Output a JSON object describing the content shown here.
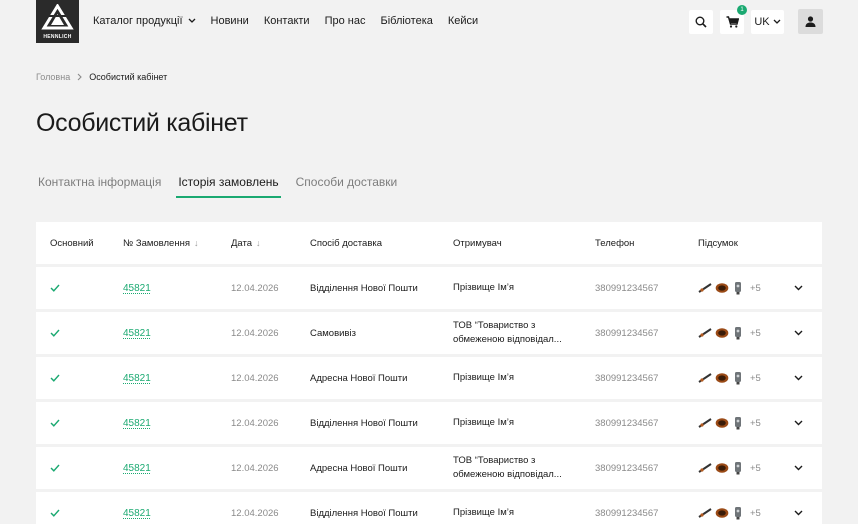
{
  "brand": {
    "logo_text": "HENNLICH"
  },
  "nav": [
    {
      "label": "Каталог продукції",
      "dropdown": true
    },
    {
      "label": "Новини"
    },
    {
      "label": "Контакти"
    },
    {
      "label": "Про нас"
    },
    {
      "label": "Бібліотека"
    },
    {
      "label": "Кейси"
    }
  ],
  "header_actions": {
    "cart_count": "1",
    "language": "UK"
  },
  "breadcrumb": {
    "home": "Головна",
    "current": "Особистий кабінет"
  },
  "page_title": "Особистий кабінет",
  "tabs": [
    {
      "label": "Контактна інформація",
      "active": false
    },
    {
      "label": "Історія замовлень",
      "active": true
    },
    {
      "label": "Способи доставки",
      "active": false
    }
  ],
  "table": {
    "headers": {
      "main": "Основний",
      "order_no": "№ Замовлення",
      "date": "Дата",
      "delivery": "Спосіб доставка",
      "recipient": "Отримувач",
      "phone": "Телефон",
      "summary": "Підсумок"
    },
    "rows": [
      {
        "order": "45821",
        "date": "12.04.2026",
        "delivery": "Відділення Нової Пошти",
        "recipient": "Прізвище Ім’я",
        "phone": "380991234567",
        "more": "+5"
      },
      {
        "order": "45821",
        "date": "12.04.2026",
        "delivery": "Самовивіз",
        "recipient": "ТОВ “Товариство з обмеженою відповідал...",
        "phone": "380991234567",
        "more": "+5"
      },
      {
        "order": "45821",
        "date": "12.04.2026",
        "delivery": "Адресна Нової Пошти",
        "recipient": "Прізвище Ім’я",
        "phone": "380991234567",
        "more": "+5"
      },
      {
        "order": "45821",
        "date": "12.04.2026",
        "delivery": "Відділення Нової Пошти",
        "recipient": "Прізвище Ім’я",
        "phone": "380991234567",
        "more": "+5"
      },
      {
        "order": "45821",
        "date": "12.04.2026",
        "delivery": "Адресна Нової Пошти",
        "recipient": "ТОВ “Товариство з обмеженою відповідал...",
        "phone": "380991234567",
        "more": "+5"
      },
      {
        "order": "45821",
        "date": "12.04.2026",
        "delivery": "Відділення Нової Пошти",
        "recipient": "Прізвище Ім’я",
        "phone": "380991234567",
        "more": "+5"
      }
    ]
  },
  "colors": {
    "accent": "#1aa971",
    "background": "#f2f2f2",
    "logo_bg": "#2a2a2a"
  }
}
